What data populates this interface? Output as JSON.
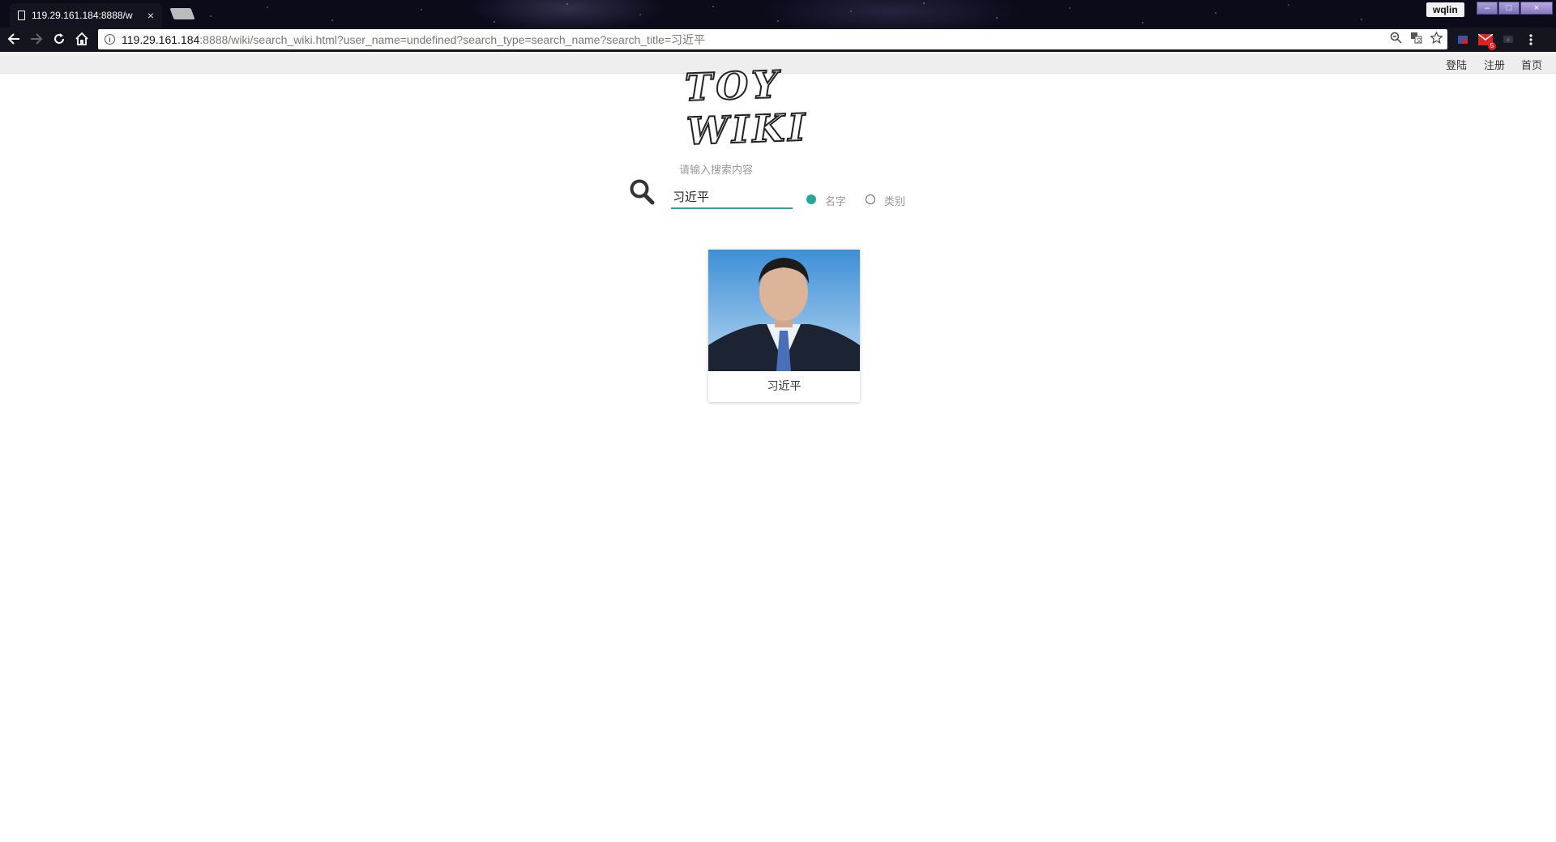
{
  "browser": {
    "tab_title": "119.29.161.184:8888/w",
    "tab_close": "×",
    "profile_name": "wqlin",
    "window_controls": [
      "–",
      "□",
      "×"
    ],
    "url_host": "119.29.161.184",
    "url_rest": ":8888/wiki/search_wiki.html?user_name=undefined?search_type=search_name?search_title=习近平",
    "omnibox_icons": [
      "zoom-icon",
      "translate-icon",
      "star-icon"
    ],
    "extensions": [
      "extension-icon",
      "mail-icon",
      "cast-icon"
    ],
    "mail_badge": "5"
  },
  "nav": {
    "login": "登陆",
    "register": "注册",
    "home": "首页"
  },
  "logo": {
    "text": "TOY WIKI"
  },
  "search": {
    "placeholder": "请输入搜索内容",
    "value": "习近平",
    "options": [
      {
        "label": "名字",
        "selected": true
      },
      {
        "label": "类别",
        "selected": false
      }
    ],
    "accent_color": "#26a69a"
  },
  "results": [
    {
      "name": "习近平"
    }
  ]
}
